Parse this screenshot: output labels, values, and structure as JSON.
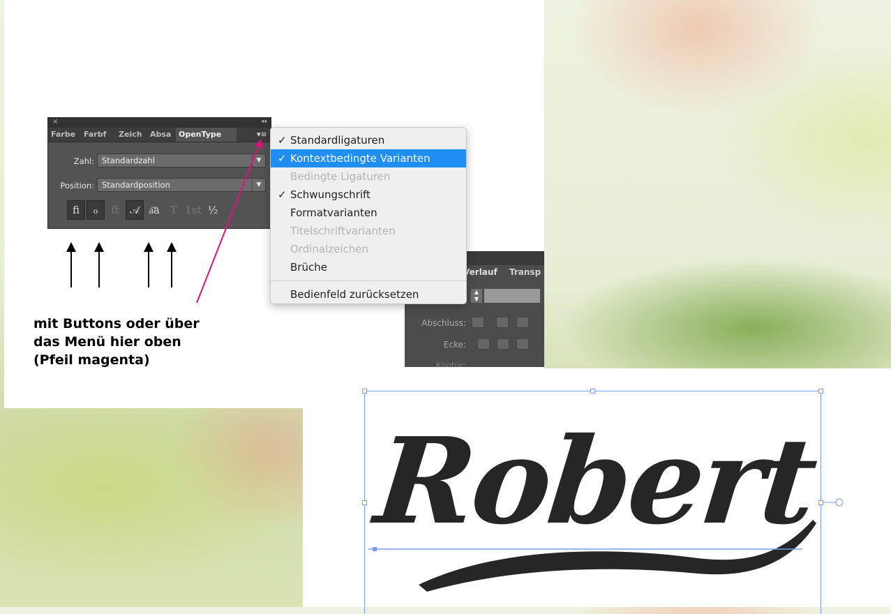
{
  "panel": {
    "close_glyph": "×",
    "collapse_glyph": "◂◂",
    "tabs": [
      "Farbe",
      "Farbf",
      "Zeich",
      "Absa",
      "OpenType"
    ],
    "menu_glyph": "▾≡",
    "zahl_label": "Zahl:",
    "zahl_value": "Standardzahl",
    "position_label": "Position:",
    "position_value": "Standardposition",
    "dropdown_arrow": "▼",
    "glyph_buttons": [
      {
        "label": "fi",
        "state": "on"
      },
      {
        "label": "ℴ",
        "state": "on"
      },
      {
        "label": "ſt",
        "state": "dim"
      },
      {
        "label": "𝒜",
        "state": "on"
      },
      {
        "label": "a͞a",
        "state": "normal"
      },
      {
        "label": "T",
        "state": "dim"
      },
      {
        "label": "1st",
        "state": "dim"
      },
      {
        "label": "½",
        "state": "normal"
      }
    ]
  },
  "menu": {
    "items": [
      {
        "label": "Standardligaturen",
        "checked": true,
        "state": "normal"
      },
      {
        "label": "Kontextbedingte Varianten",
        "checked": true,
        "state": "selected"
      },
      {
        "label": "Bedingte Ligaturen",
        "checked": false,
        "state": "disabled"
      },
      {
        "label": "Schwungschrift",
        "checked": true,
        "state": "normal"
      },
      {
        "label": "Formatvarianten",
        "checked": false,
        "state": "normal"
      },
      {
        "label": "Titelschriftvarianten",
        "checked": false,
        "state": "disabled"
      },
      {
        "label": "Ordinalzeichen",
        "checked": false,
        "state": "disabled"
      },
      {
        "label": "Brüche",
        "checked": false,
        "state": "normal"
      }
    ],
    "reset_label": "Bedienfeld zurücksetzen",
    "check_glyph": "✓"
  },
  "panel2": {
    "tab1": "Verlauf",
    "tab2": "Transp",
    "abschluss_label": "Abschluss:",
    "ecke_label": "Ecke:",
    "third_label": "Kontur:"
  },
  "annotation": {
    "line1": "mit Buttons oder über",
    "line2": "das Menü hier oben",
    "line3": "(Pfeil magenta)"
  },
  "canvas": {
    "text": "Robert"
  },
  "colors": {
    "highlight": "#1e8ef3",
    "magenta_arrow": "#e0117f",
    "selection": "#7a9cf0"
  }
}
